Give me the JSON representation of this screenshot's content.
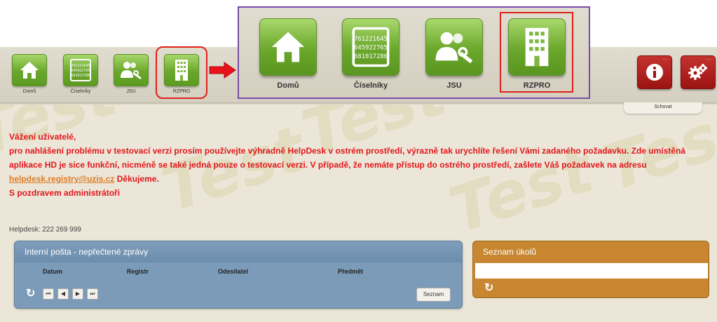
{
  "toolbar": {
    "tiles": [
      {
        "label": "Domů",
        "icon": "home-icon"
      },
      {
        "label": "Číselníky",
        "icon": "codebook-icon",
        "icon_text": [
          "761221645",
          "645922765",
          "681017286"
        ]
      },
      {
        "label": "JSU",
        "icon": "users-wrench-icon"
      },
      {
        "label": "RZPRO",
        "icon": "building-icon"
      }
    ],
    "zoom_tiles": [
      {
        "label": "Domů"
      },
      {
        "label": "Číselníky",
        "icon_text": [
          "761221645",
          "645922765",
          "681017286"
        ]
      },
      {
        "label": "JSU"
      },
      {
        "label": "RZPRO"
      }
    ],
    "right_tiles": [
      {
        "icon": "info-icon"
      },
      {
        "icon": "gears-icon"
      }
    ],
    "hide_label": "Schovat"
  },
  "watermark": "Test",
  "message": {
    "line1": "Vážení uživatelé,",
    "line2": "pro nahlášení problému v testovací verzi prosím používejte výhradně HelpDesk v ostrém prostředí, výrazně tak urychlíte řešení Vámi zadaného požadavku. Zde umístěná aplikace HD je sice funkční, nicméně se také jedná pouze o testovací verzi. V případě, že nemáte přístup do ostrého prostředí, zašlete Váš požadavek na adresu",
    "email": "helpdesk.registry@uzis.cz",
    "after_email": "Děkujeme.",
    "line3": "S pozdravem administrátoři"
  },
  "helpdesk": "Helpdesk: 222 269 999",
  "mail_panel": {
    "title": "Interní pošta - nepřečtené zprávy",
    "columns": [
      "Datum",
      "Registr",
      "Odesílatel",
      "Předmět"
    ],
    "pager": [
      "⏮",
      "◀",
      "▶",
      "⏭"
    ],
    "list_button": "Seznam"
  },
  "tasks_panel": {
    "title": "Seznam úkolů"
  },
  "colors": {
    "green": "#6aa72b",
    "red_highlight": "#e0211b",
    "purple_frame": "#7b4ca8",
    "message_red": "#e3161a",
    "mail_blue": "#7b9bb8",
    "tasks_orange": "#c7862f"
  }
}
